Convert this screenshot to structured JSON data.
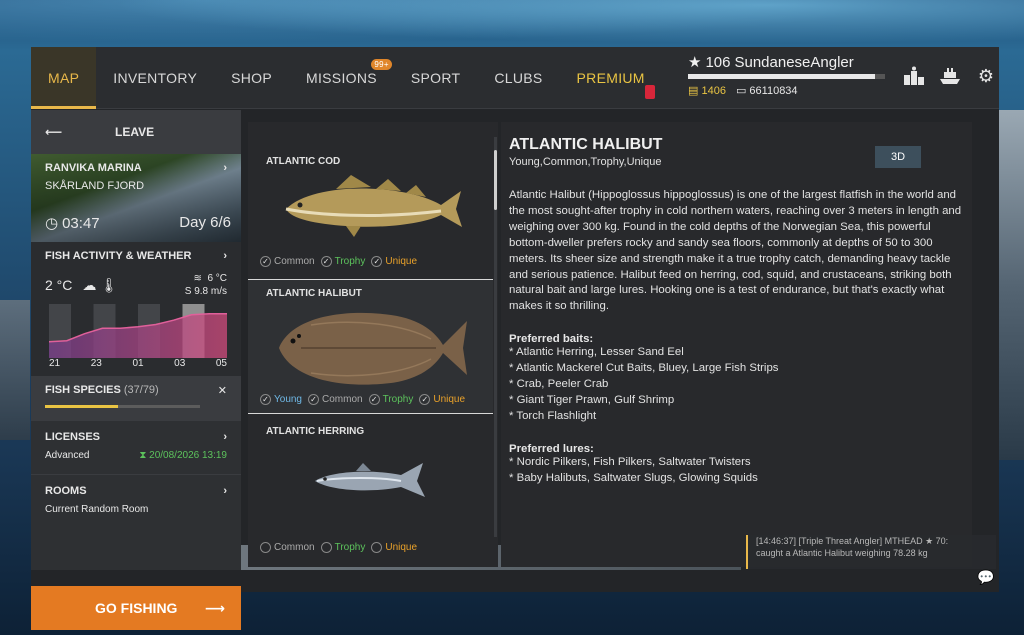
{
  "nav": {
    "items": [
      "MAP",
      "INVENTORY",
      "SHOP",
      "MISSIONS",
      "SPORT",
      "CLUBS",
      "PREMIUM"
    ],
    "missions_badge": "99+"
  },
  "profile": {
    "level": "106",
    "name": "SundaneseAngler",
    "xp_fraction": 0.95,
    "gold": "1406",
    "silver": "66110834"
  },
  "sidebar": {
    "leave": "LEAVE",
    "location": "RANVIKA MARINA",
    "region": "SKÅRLAND FJORD",
    "time": "03:47",
    "day": "Day 6/6",
    "weather_title": "FISH ACTIVITY & WEATHER",
    "air_temp": "2 °C",
    "water_temp": "6 °C",
    "wind": "S 9.8 m/s",
    "hours": [
      "21",
      "23",
      "01",
      "03",
      "05"
    ],
    "activity": [
      0.3,
      0.32,
      0.45,
      0.55,
      0.55,
      0.58,
      0.62,
      0.7,
      0.8,
      0.82,
      0.82
    ],
    "species_title": "FISH SPECIES",
    "species_count": "(37/79)",
    "species_fraction": 0.47,
    "licenses_title": "LICENSES",
    "license_type": "Advanced",
    "license_date": "20/08/2026 13:19",
    "rooms_title": "ROOMS",
    "room": "Current Random Room",
    "go": "GO FISHING"
  },
  "fish_list": [
    {
      "name": "ATLANTIC COD",
      "tags": [
        "Common",
        "Trophy",
        "Unique"
      ],
      "checked": [
        true,
        true,
        true
      ]
    },
    {
      "name": "ATLANTIC HALIBUT",
      "tags": [
        "Young",
        "Common",
        "Trophy",
        "Unique"
      ],
      "checked": [
        true,
        true,
        true,
        true
      ]
    },
    {
      "name": "ATLANTIC HERRING",
      "tags": [
        "Common",
        "Trophy",
        "Unique"
      ],
      "checked": [
        false,
        false,
        false
      ]
    }
  ],
  "details": {
    "title": "ATLANTIC HALIBUT",
    "tags": "Young,Common,Trophy,Unique",
    "btn3d": "3D",
    "description": "Atlantic Halibut (Hippoglossus hippoglossus) is one of the largest flatfish in the world and the most sought-after trophy in cold northern waters, reaching over 3 meters in length and weighing over 300 kg. Found in the cold depths of the Norwegian Sea, this powerful bottom-dweller prefers rocky and sandy sea floors, commonly at depths of 50 to 300 meters. Its sheer size and strength make it a true trophy catch, demanding heavy tackle and serious patience. Halibut feed on herring, cod, squid, and crustaceans, striking both natural bait and large lures. Hooking one is a test of endurance, but that's exactly what makes it so thrilling.",
    "baits_title": "Preferred baits:",
    "baits": [
      "* Atlantic Herring, Lesser Sand Eel",
      "* Atlantic Mackerel Cut Baits, Bluey, Large Fish Strips",
      "* Crab, Peeler Crab",
      "* Giant Tiger Prawn, Gulf Shrimp",
      "* Torch Flashlight"
    ],
    "lures_title": "Preferred lures:",
    "lures": [
      "* Nordic Pilkers, Fish Pilkers, Saltwater Twisters",
      "* Baby Halibuts, Saltwater Slugs, Glowing Squids"
    ]
  },
  "chat": {
    "line1": "[14:46:37] [Triple Threat Angler] MTHEAD ★ 70:",
    "line2": "caught a Atlantic Halibut weighing 78.28 kg"
  },
  "colors": {
    "accent": "#e9b84a",
    "go_button": "#e47a22",
    "trophy": "#5cc25c",
    "unique": "#e9a12a",
    "young": "#6fb8e6"
  }
}
